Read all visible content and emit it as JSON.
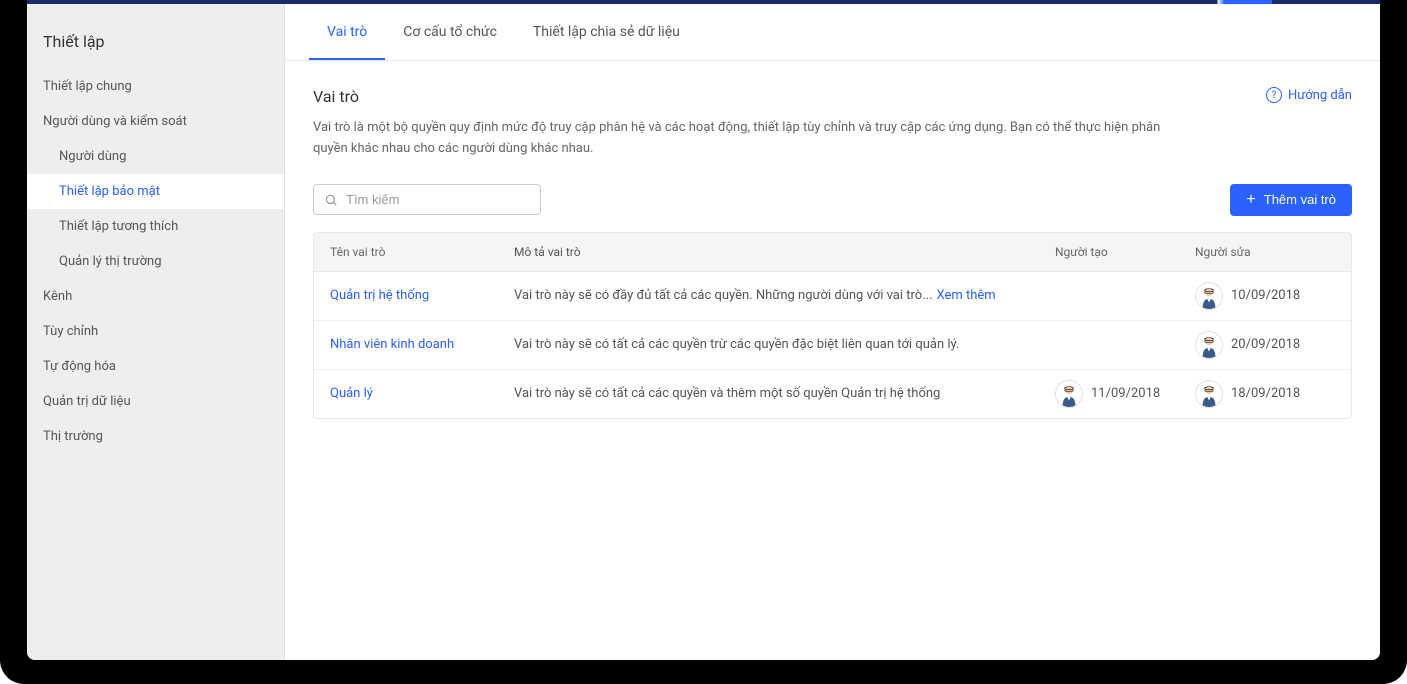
{
  "sidebar": {
    "title": "Thiết lập",
    "items": [
      {
        "label": "Thiết lập chung",
        "type": "item"
      },
      {
        "label": "Người dùng và kiểm soát",
        "type": "item"
      },
      {
        "label": "Người dùng",
        "type": "sub"
      },
      {
        "label": "Thiết lập bảo mật",
        "type": "sub",
        "active": true
      },
      {
        "label": "Thiết lập tương thích",
        "type": "sub"
      },
      {
        "label": "Quản lý thị trường",
        "type": "sub"
      },
      {
        "label": "Kênh",
        "type": "item"
      },
      {
        "label": "Tùy chỉnh",
        "type": "item"
      },
      {
        "label": "Tự động hóa",
        "type": "item"
      },
      {
        "label": "Quản trị dữ liệu",
        "type": "item"
      },
      {
        "label": "Thị trường",
        "type": "item"
      }
    ]
  },
  "tabs": [
    {
      "label": "Vai trò",
      "active": true
    },
    {
      "label": "Cơ cấu tổ chức"
    },
    {
      "label": "Thiết lập chia sẻ dữ liệu"
    }
  ],
  "page": {
    "title": "Vai trò",
    "help_label": "Hướng dẫn",
    "description": "Vai trò là một bộ quyền quy định mức độ truy cập phân hệ và các hoạt động, thiết lập tùy chỉnh và truy cập các ứng dụng. Bạn có thể thực hiện phân quyền khác nhau cho các người dùng khác nhau."
  },
  "toolbar": {
    "search_placeholder": "Tìm kiếm",
    "add_label": "Thêm vai trò"
  },
  "table": {
    "headers": {
      "name": "Tên vai trò",
      "desc": "Mô tả vai trò",
      "creator": "Người tạo",
      "editor": "Người sửa"
    },
    "see_more_label": "Xem thêm",
    "rows": [
      {
        "name": "Quản trị hệ thống",
        "desc": "Vai trò này sẽ có đầy đủ tất cả các quyền. Những người dùng với vai trò...",
        "see_more": true,
        "creator": {
          "avatar": false,
          "date": ""
        },
        "editor": {
          "avatar": true,
          "date": "10/09/2018"
        }
      },
      {
        "name": "Nhân viên kinh doanh",
        "desc": "Vai trò này sẽ có tất cả các quyền trừ các quyền đặc biệt liên quan tới quản lý.",
        "see_more": false,
        "creator": {
          "avatar": false,
          "date": ""
        },
        "editor": {
          "avatar": true,
          "date": "20/09/2018"
        }
      },
      {
        "name": "Quản lý",
        "desc": "Vai trò này sẽ có tất cả các quyền và thêm một số quyền Quản trị hệ thống",
        "see_more": false,
        "creator": {
          "avatar": true,
          "date": "11/09/2018"
        },
        "editor": {
          "avatar": true,
          "date": "18/09/2018"
        }
      }
    ]
  }
}
